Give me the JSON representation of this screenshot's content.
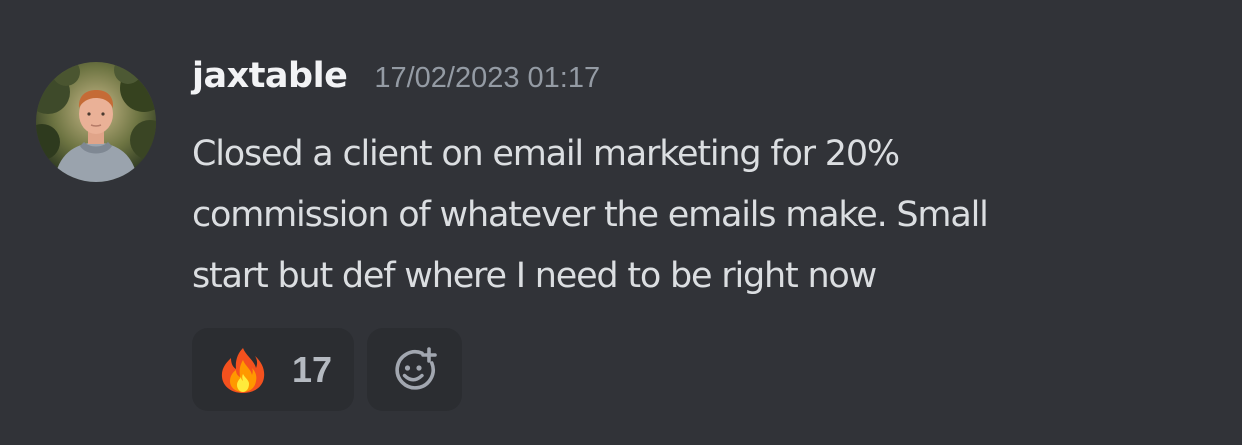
{
  "message": {
    "author": "jaxtable",
    "timestamp": "17/02/2023 01:17",
    "content_lines": [
      "Closed a client on email marketing for 20%",
      "commission of whatever the emails make. Small",
      "start but def where I need to be right now"
    ],
    "avatar_icon": "user-avatar-photo"
  },
  "reactions": [
    {
      "emoji": "🔥",
      "icon": "fire-emoji-icon",
      "count": "17"
    }
  ],
  "add_reaction": {
    "icon": "add-reaction-icon"
  },
  "colors": {
    "background": "#313338",
    "username": "#f2f3f5",
    "timestamp": "#949ba4",
    "text": "#dbdee1",
    "reaction_bg": "#2b2d31",
    "reaction_count": "#b5bac1"
  }
}
